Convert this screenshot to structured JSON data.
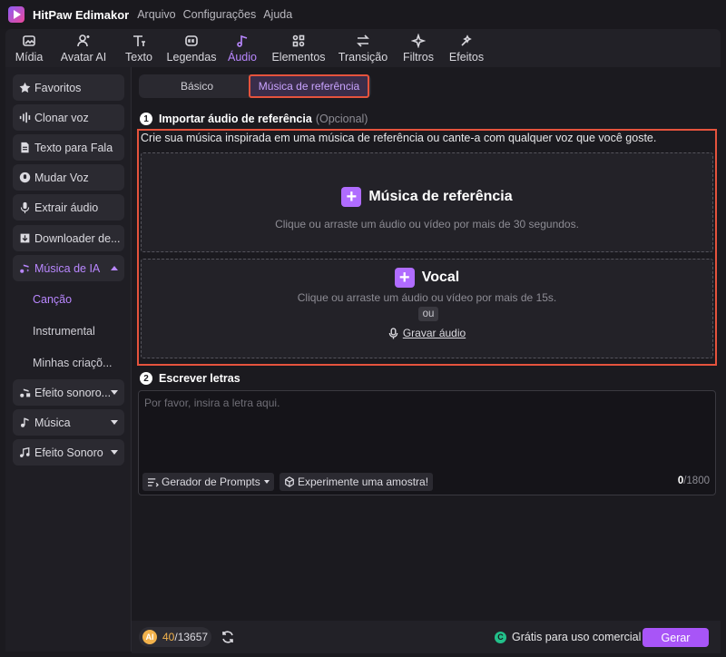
{
  "app": {
    "name": "HitPaw Edimakor",
    "menu": [
      "Arquivo",
      "Configurações",
      "Ajuda"
    ]
  },
  "toolbar": {
    "tabs": [
      {
        "label": "Mídia",
        "icon": "media-icon"
      },
      {
        "label": "Avatar AI",
        "icon": "avatar-icon"
      },
      {
        "label": "Texto",
        "icon": "text-icon"
      },
      {
        "label": "Legendas",
        "icon": "captions-icon"
      },
      {
        "label": "Áudio",
        "icon": "audio-icon",
        "active": true
      },
      {
        "label": "Elementos",
        "icon": "elements-icon"
      },
      {
        "label": "Transição",
        "icon": "transition-icon"
      },
      {
        "label": "Filtros",
        "icon": "filters-icon"
      },
      {
        "label": "Efeitos",
        "icon": "effects-icon"
      }
    ]
  },
  "sidebar": {
    "items": [
      {
        "label": "Favoritos",
        "icon": "star-icon"
      },
      {
        "label": "Clonar voz",
        "icon": "waveform-icon"
      },
      {
        "label": "Texto para Fala",
        "icon": "document-icon"
      },
      {
        "label": "Mudar Voz",
        "icon": "voice-change-icon"
      },
      {
        "label": "Extrair áudio",
        "icon": "microphone-icon"
      },
      {
        "label": "Downloader de...",
        "icon": "download-icon"
      },
      {
        "label": "Música de IA",
        "icon": "ai-music-icon",
        "expanded": true
      },
      {
        "label": "Efeito sonoro...",
        "icon": "sound-effect-icon"
      },
      {
        "label": "Música",
        "icon": "music-note-icon"
      },
      {
        "label": "Efeito Sonoro",
        "icon": "music-notes-icon"
      }
    ],
    "sub_items": [
      {
        "label": "Canção",
        "active": true
      },
      {
        "label": "Instrumental"
      },
      {
        "label": "Minhas criaçõ..."
      }
    ]
  },
  "mode_tabs": {
    "basic": "Básico",
    "reference": "Música de referência"
  },
  "step1": {
    "number": "1",
    "title": "Importar áudio de referência",
    "optional": "(Opcional)",
    "description": "Crie sua música inspirada em uma música de referência ou cante-a com qualquer voz que você goste.",
    "reference_zone": {
      "title": "Música de referência",
      "hint": "Clique ou arraste um áudio ou vídeo por mais de 30 segundos."
    },
    "vocal_zone": {
      "title": "Vocal",
      "hint": "Clique ou arraste um áudio ou vídeo por mais de 15s.",
      "or": "ou",
      "record": "Gravar áudio"
    }
  },
  "step2": {
    "number": "2",
    "title": "Escrever letras",
    "placeholder": "Por favor, insira a letra aqui.",
    "prompt_generator": "Gerador de Prompts",
    "try_sample": "Experimente uma amostra!",
    "char_count": "0",
    "char_max": "/1800"
  },
  "footer": {
    "credits_used": "40",
    "credits_total": "/13657",
    "free_commercial": "Grátis para uso comercial",
    "generate": "Gerar"
  },
  "colors": {
    "accent": "#a855f7",
    "highlight_border": "#e5533d",
    "background": "#1b1a1f"
  }
}
